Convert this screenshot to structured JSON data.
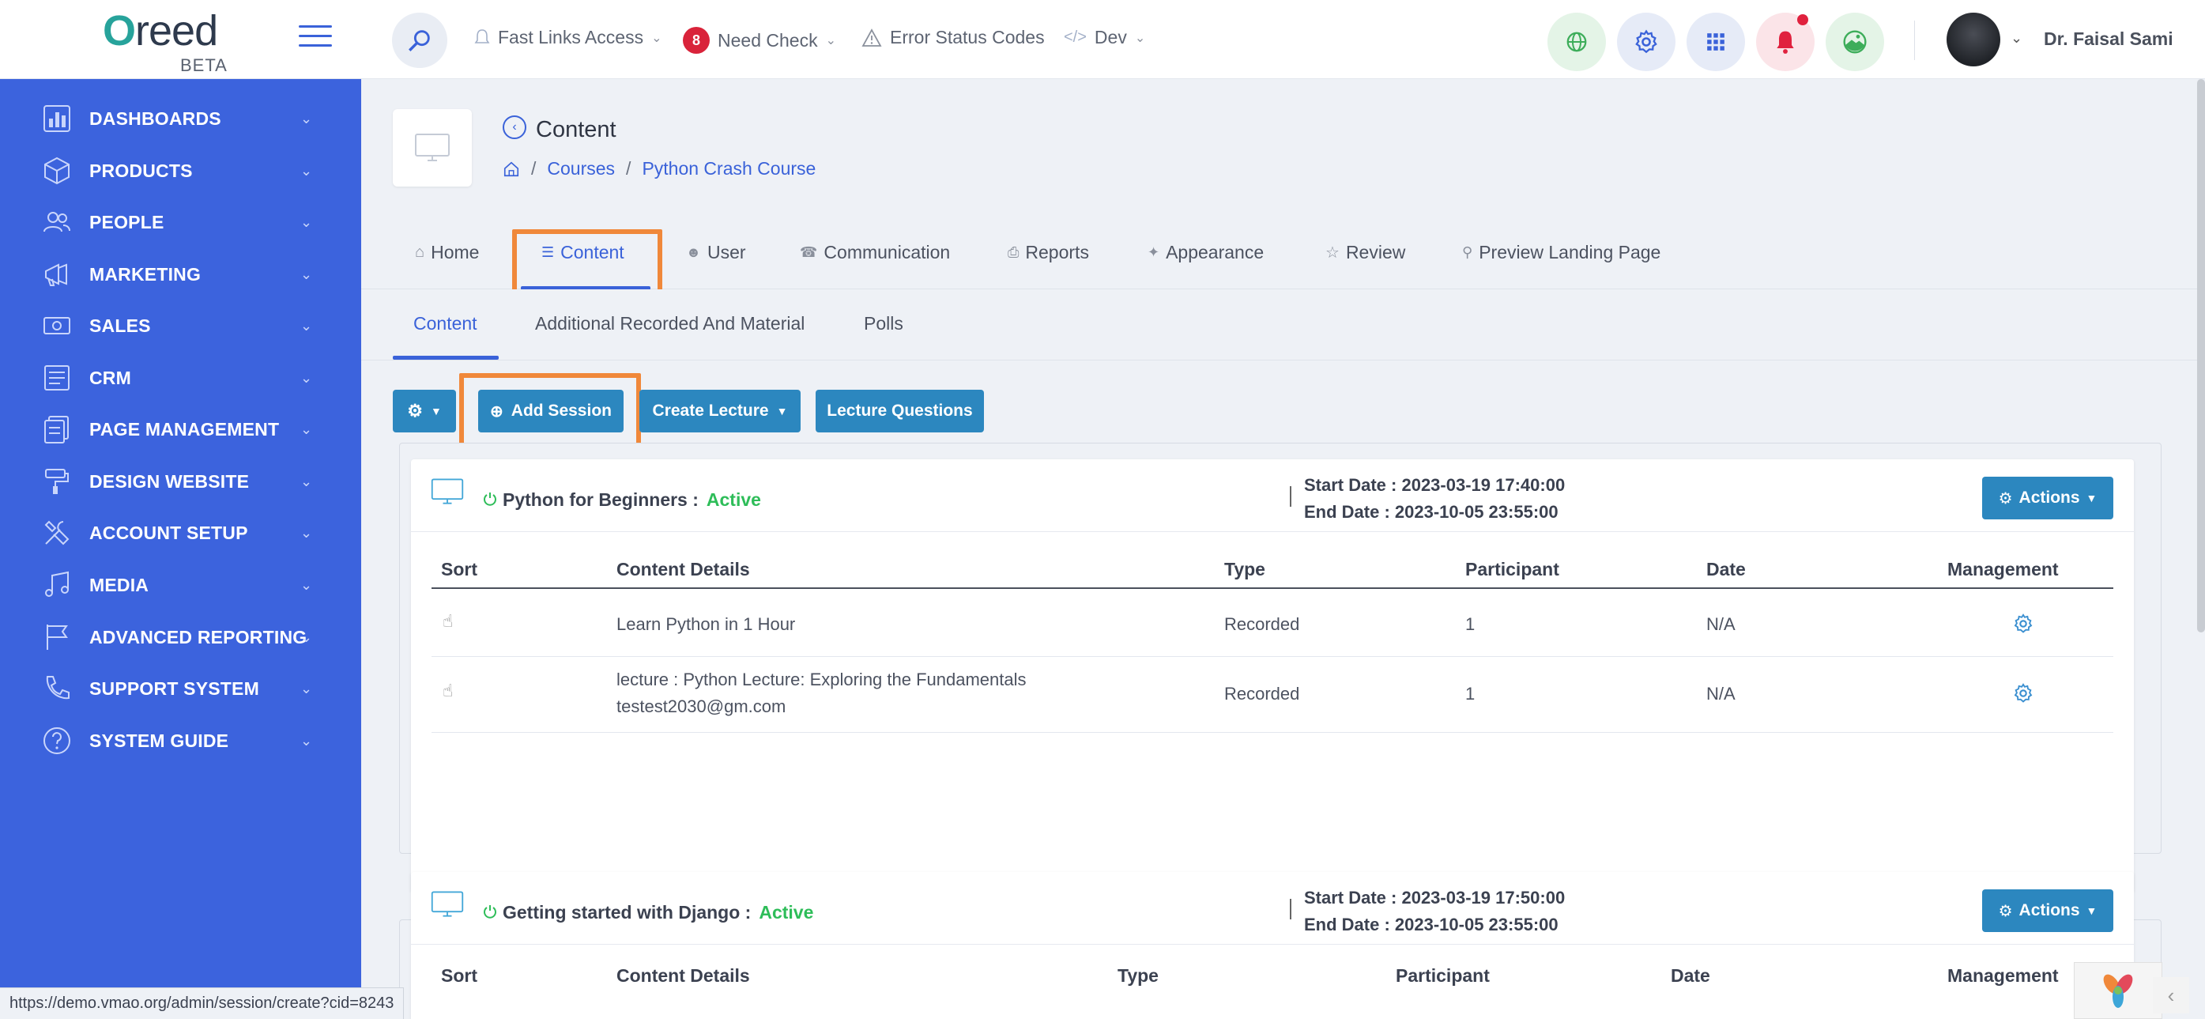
{
  "brand": {
    "logo_text_o": "O",
    "logo_text_rest": "reed",
    "beta": "BETA"
  },
  "topnav": {
    "fast_links": "Fast Links Access",
    "need_check_count": "8",
    "need_check": "Need Check",
    "error_codes": "Error Status Codes",
    "dev": "Dev",
    "user_name": "Dr. Faisal Sami"
  },
  "sidebar": {
    "items": [
      {
        "label": "DASHBOARDS",
        "icon": "dashboard-icon"
      },
      {
        "label": "PRODUCTS",
        "icon": "cube-icon"
      },
      {
        "label": "PEOPLE",
        "icon": "people-icon"
      },
      {
        "label": "MARKETING",
        "icon": "megaphone-icon"
      },
      {
        "label": "SALES",
        "icon": "cash-icon"
      },
      {
        "label": "CRM",
        "icon": "crm-icon"
      },
      {
        "label": "PAGE MANAGEMENT",
        "icon": "pages-icon"
      },
      {
        "label": "DESIGN WEBSITE",
        "icon": "paint-roller-icon"
      },
      {
        "label": "ACCOUNT SETUP",
        "icon": "tools-icon"
      },
      {
        "label": "MEDIA",
        "icon": "music-icon"
      },
      {
        "label": "ADVANCED REPORTING",
        "icon": "flag-icon"
      },
      {
        "label": "SUPPORT SYSTEM",
        "icon": "phone-icon"
      },
      {
        "label": "SYSTEM GUIDE",
        "icon": "help-icon"
      }
    ]
  },
  "header": {
    "title": "Content",
    "breadcrumb": [
      "Courses",
      "Python Crash Course"
    ]
  },
  "tabs": [
    {
      "label": "Home"
    },
    {
      "label": "Content"
    },
    {
      "label": "User"
    },
    {
      "label": "Communication"
    },
    {
      "label": "Reports"
    },
    {
      "label": "Appearance"
    },
    {
      "label": "Review"
    },
    {
      "label": "Preview Landing Page"
    }
  ],
  "subtabs": [
    {
      "label": "Content"
    },
    {
      "label": "Additional Recorded And Material"
    },
    {
      "label": "Polls"
    }
  ],
  "toolbar": {
    "add_session": "Add Session",
    "create_lecture": "Create Lecture",
    "lecture_questions": "Lecture Questions"
  },
  "table_headers": [
    "Sort",
    "Content Details",
    "Type",
    "Participant",
    "Date",
    "Management"
  ],
  "sessions": [
    {
      "title": "Python for Beginners :",
      "status": "Active",
      "start": "Start Date : 2023-03-19 17:40:00",
      "end": "End Date : 2023-10-05 23:55:00",
      "actions": "Actions",
      "rows": [
        {
          "details": "Learn Python in 1 Hour",
          "details2": "",
          "type": "Recorded",
          "participant": "1",
          "date": "N/A"
        },
        {
          "details": "lecture : Python Lecture: Exploring the Fundamentals",
          "details2": "testest2030@gm.com",
          "type": "Recorded",
          "participant": "1",
          "date": "N/A"
        }
      ]
    },
    {
      "title": "Getting started with Django :",
      "status": "Active",
      "start": "Start Date : 2023-03-19 17:50:00",
      "end": "End Date : 2023-10-05 23:55:00",
      "actions": "Actions"
    }
  ],
  "status_url": "https://demo.vmao.org/admin/session/create?cid=8243",
  "colors": {
    "sidebar": "#3c63dd",
    "accent": "#3a62d9",
    "button": "#2c87bf",
    "highlight": "#f0883a",
    "active": "#2ebd59"
  }
}
